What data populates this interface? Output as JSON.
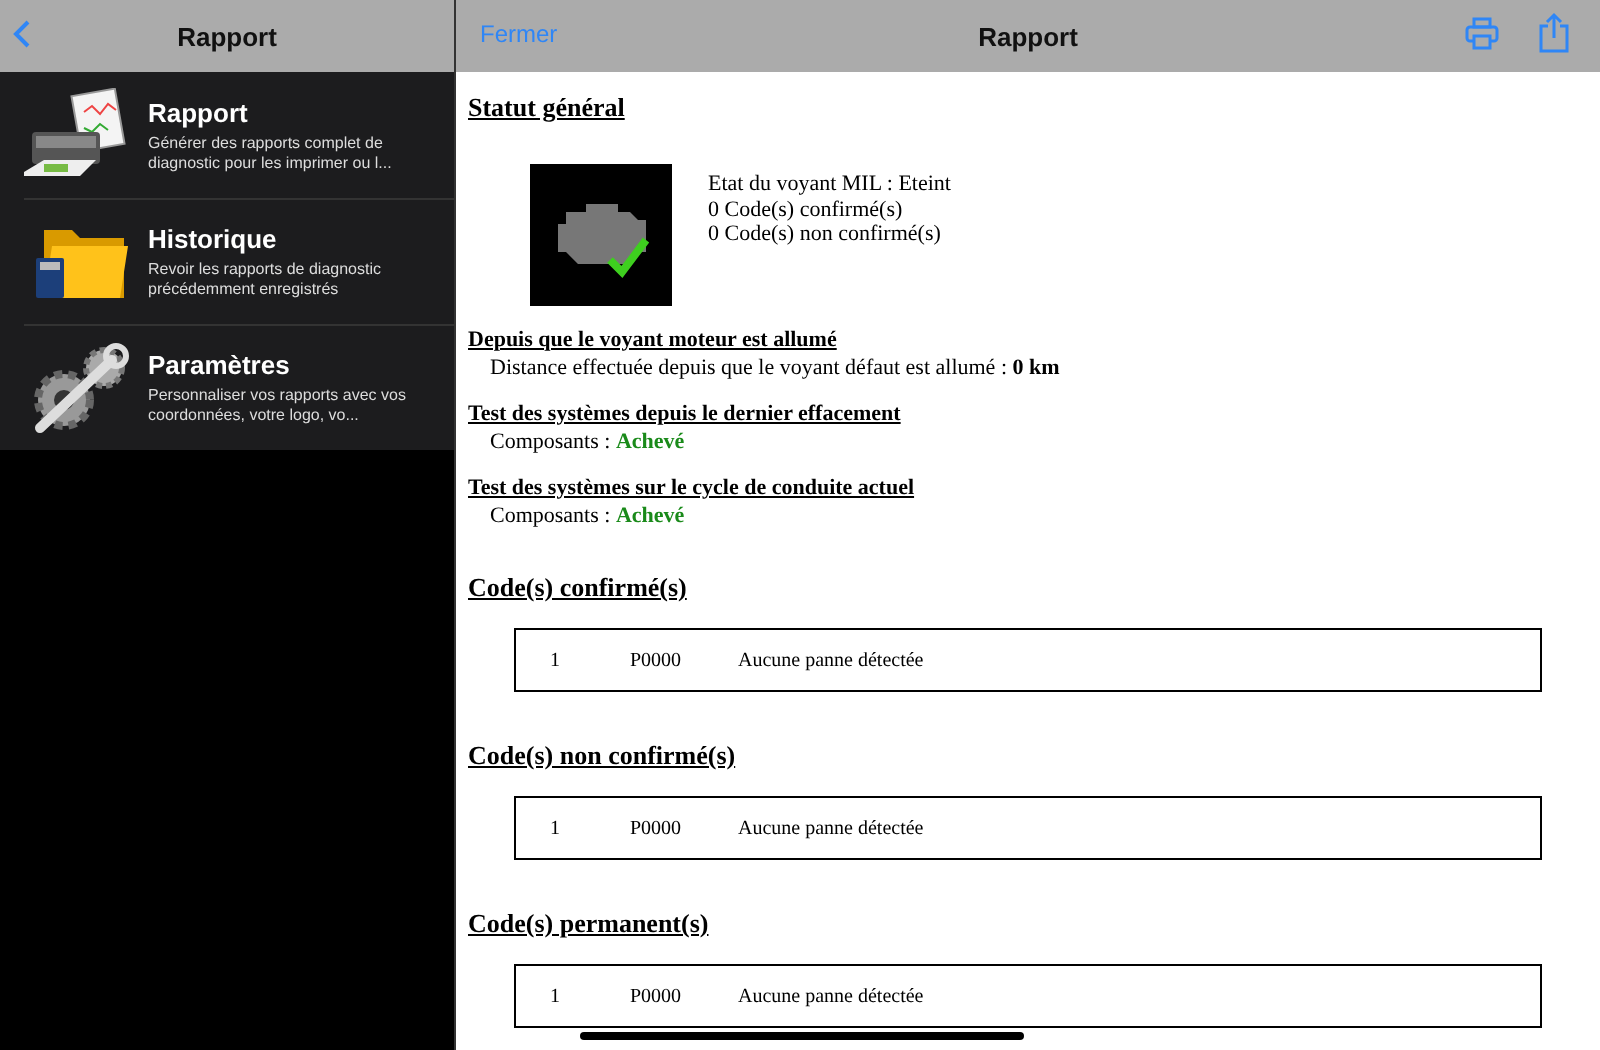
{
  "sidebar": {
    "title": "Rapport",
    "items": [
      {
        "kind": "report",
        "title": "Rapport",
        "description": "Générer des rapports complet de diagnostic pour les imprimer ou l..."
      },
      {
        "kind": "history",
        "title": "Historique",
        "description": "Revoir les rapports de diagnostic précédemment enregistrés"
      },
      {
        "kind": "settings",
        "title": "Paramètres",
        "description": "Personnaliser vos rapports avec vos coordonnées, votre logo, vo..."
      }
    ]
  },
  "report": {
    "close_label": "Fermer",
    "title": "Rapport",
    "general_status": {
      "heading": "Statut général",
      "lines": [
        "Etat du voyant MIL : Eteint",
        "0 Code(s) confirmé(s)",
        "0 Code(s) non confirmé(s)"
      ]
    },
    "sections": [
      {
        "heading": "Depuis que le voyant moteur est allumé",
        "text": "Distance effectuée depuis que le voyant défaut est allumé : **0 km**"
      },
      {
        "heading": "Test des systèmes depuis le dernier effacement",
        "label": "Composants : ",
        "value": "Achevé"
      },
      {
        "heading": "Test des systèmes sur le cycle de conduite actuel",
        "label": "Composants : ",
        "value": "Achevé"
      }
    ],
    "code_groups": [
      {
        "heading": "Code(s) confirmé(s)",
        "rows": [
          [
            "1",
            "P0000",
            "Aucune panne détectée"
          ]
        ]
      },
      {
        "heading": "Code(s) non confirmé(s)",
        "rows": [
          [
            "1",
            "P0000",
            "Aucune panne détectée"
          ]
        ]
      },
      {
        "heading": "Code(s) permanent(s)",
        "rows": [
          [
            "1",
            "P0000",
            "Aucune panne détectée"
          ]
        ]
      }
    ]
  }
}
